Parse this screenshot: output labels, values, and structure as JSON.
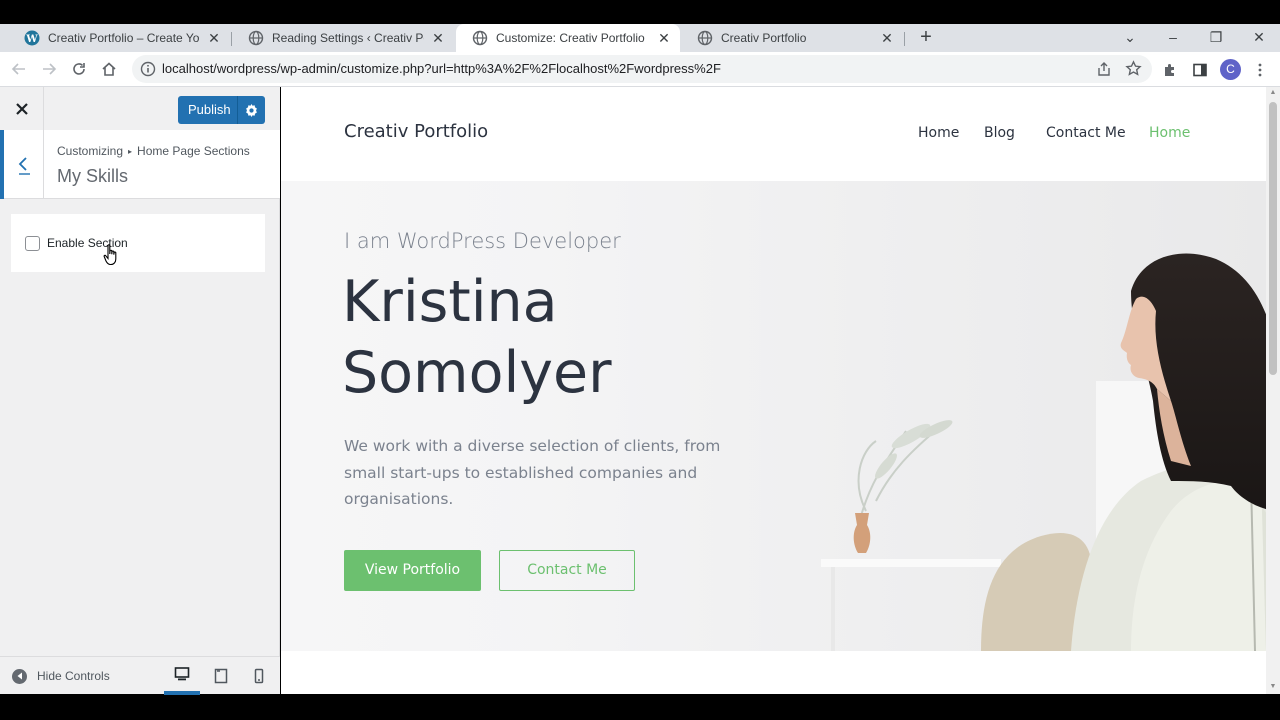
{
  "browser": {
    "tabs": [
      {
        "title": "Creativ Portfolio – Create Your O",
        "icon": "wordpress-icon",
        "active": false
      },
      {
        "title": "Reading Settings ‹ Creativ Portfo",
        "icon": "globe-icon",
        "active": false
      },
      {
        "title": "Customize: Creativ Portfolio",
        "icon": "globe-icon",
        "active": true
      },
      {
        "title": "Creativ Portfolio",
        "icon": "globe-icon",
        "active": false
      }
    ],
    "url": "localhost/wordpress/wp-admin/customize.php?url=http%3A%2F%2Flocalhost%2Fwordpress%2F",
    "profile_initial": "C"
  },
  "customizer": {
    "publish_label": "Publish",
    "breadcrumb_root": "Customizing",
    "breadcrumb_parent": "Home Page Sections",
    "section_title": "My Skills",
    "enable_section_label": "Enable Section",
    "enable_section_checked": false,
    "hide_controls_label": "Hide Controls",
    "devices": [
      "desktop",
      "tablet",
      "mobile"
    ],
    "active_device": "desktop"
  },
  "site": {
    "title": "Creativ Portfolio",
    "nav": [
      "Home",
      "Blog",
      "Contact Me",
      "Home"
    ],
    "hero_sub": "I am WordPress Developer",
    "hero_name_line1": "Kristina",
    "hero_name_line2": "Somolyer",
    "hero_desc": "We work with a diverse selection of clients, from small start-ups to established companies and organisations.",
    "btn_primary": "View Portfolio",
    "btn_secondary": "Contact Me",
    "accent_color": "#6cc06f"
  }
}
